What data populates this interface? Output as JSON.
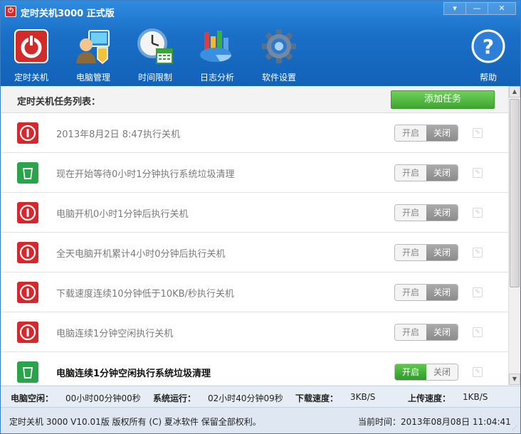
{
  "window": {
    "title": "定时关机3000 正式版",
    "controls": {
      "menu": "▾",
      "minimize": "—",
      "close": "✕"
    }
  },
  "toolbar": {
    "items": [
      {
        "label": "定时关机",
        "icon": "power-icon"
      },
      {
        "label": "电脑管理",
        "icon": "computer-user-icon"
      },
      {
        "label": "时间限制",
        "icon": "clock-calendar-icon"
      },
      {
        "label": "日志分析",
        "icon": "chart-icon"
      },
      {
        "label": "软件设置",
        "icon": "gear-icon"
      }
    ],
    "help": {
      "label": "帮助",
      "icon": "help-icon"
    }
  },
  "task_list": {
    "title": "定时关机任务列表：",
    "add_button": "添加任务",
    "toggle_on_label": "开启",
    "toggle_off_label": "关闭",
    "rows": [
      {
        "text": "2013年8月2日 8:47执行关机",
        "type": "shutdown",
        "enabled": false
      },
      {
        "text": "现在开始等待0小时1分钟执行系统垃圾清理",
        "type": "cleanup",
        "enabled": false
      },
      {
        "text": "电脑开机0小时1分钟后执行关机",
        "type": "shutdown",
        "enabled": false
      },
      {
        "text": "全天电脑开机累计4小时0分钟后执行关机",
        "type": "shutdown",
        "enabled": false
      },
      {
        "text": "下载速度连续10分钟低于10KB/秒执行关机",
        "type": "shutdown",
        "enabled": false
      },
      {
        "text": "电脑连续1分钟空闲执行关机",
        "type": "shutdown",
        "enabled": false
      },
      {
        "text": "电脑连续1分钟空闲执行系统垃圾清理",
        "type": "cleanup",
        "enabled": true
      }
    ]
  },
  "status": {
    "idle_label": "电脑空闲：",
    "idle_value": "00小时00分钟00秒",
    "run_label": "系统运行：",
    "run_value": "02小时40分钟09秒",
    "download_label": "下载速度：",
    "download_value": "3KB/S",
    "upload_label": "上传速度：",
    "upload_value": "1KB/S"
  },
  "footer": {
    "copyright": "定时关机 3000 V10.01版  版权所有 (C)  夏冰软件 保留全部权利。",
    "current_time": "当前时间：2013年08月08日 11:04:41"
  },
  "colors": {
    "title_bar": "#1a6fc6",
    "add_button": "#4cb13c",
    "shutdown_icon": "#d8262b",
    "cleanup_icon": "#2aa44a",
    "toggle_active": "#3fa532"
  }
}
